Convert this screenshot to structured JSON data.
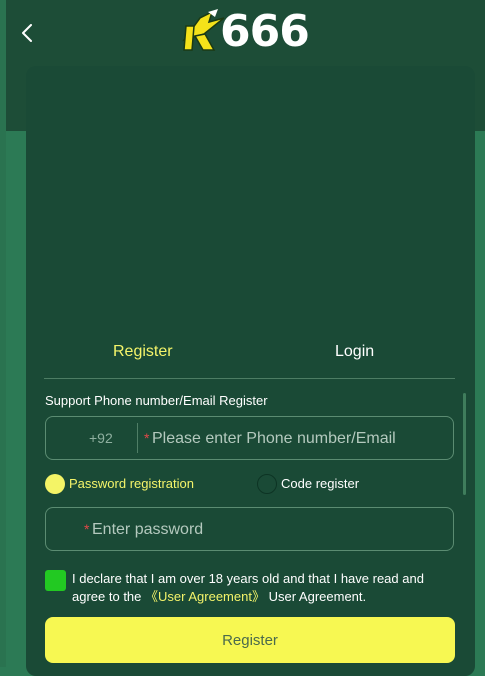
{
  "header": {
    "back_icon": "chevron-left-icon",
    "logo_text": "666"
  },
  "tabs": {
    "register_label": "Register",
    "login_label": "Login",
    "active": "register"
  },
  "form": {
    "support_label": "Support Phone number/Email Register",
    "phone": {
      "prefix": "+92",
      "required_mark": "*",
      "placeholder": "Please enter Phone number/Email",
      "value": ""
    },
    "methods": {
      "password_label": "Password registration",
      "code_label": "Code register",
      "selected": "password"
    },
    "password": {
      "required_mark": "*",
      "placeholder": "Enter password",
      "value": ""
    },
    "agreement": {
      "checked": true,
      "text_line": "I declare that I am over 18 years old and that I have read and agree to the",
      "link_text": "《User Agreement》",
      "suffix": "User Agreement."
    },
    "submit_label": "Register"
  },
  "colors": {
    "accent_yellow": "#f4f46a",
    "card_green": "#1a4a36",
    "header_green": "#1d4d37",
    "background_green": "#2c7a55",
    "checkbox_green": "#22c922",
    "required_red": "#e04848"
  }
}
